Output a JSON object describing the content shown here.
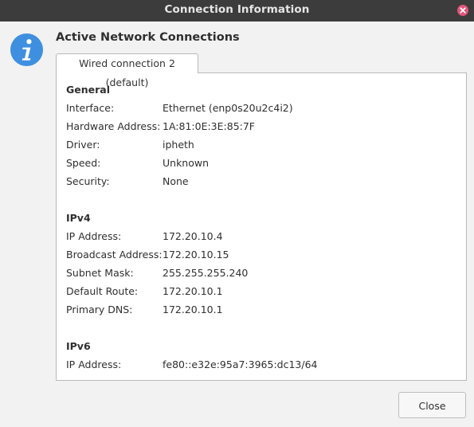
{
  "window": {
    "title": "Connection Information"
  },
  "icons": {
    "info": "info-icon",
    "close": "close-icon"
  },
  "heading": "Active Network Connections",
  "tab": {
    "label": "Wired connection 2 (default)"
  },
  "sections": {
    "general": {
      "title": "General",
      "rows": [
        {
          "label": "Interface:",
          "value": "Ethernet (enp0s20u2c4i2)"
        },
        {
          "label": "Hardware Address:",
          "value": "1A:81:0E:3E:85:7F"
        },
        {
          "label": "Driver:",
          "value": "ipheth"
        },
        {
          "label": "Speed:",
          "value": "Unknown"
        },
        {
          "label": "Security:",
          "value": "None"
        }
      ]
    },
    "ipv4": {
      "title": "IPv4",
      "rows": [
        {
          "label": "IP Address:",
          "value": "172.20.10.4"
        },
        {
          "label": "Broadcast Address:",
          "value": "172.20.10.15"
        },
        {
          "label": "Subnet Mask:",
          "value": "255.255.255.240"
        },
        {
          "label": "Default Route:",
          "value": "172.20.10.1"
        },
        {
          "label": "Primary DNS:",
          "value": "172.20.10.1"
        }
      ]
    },
    "ipv6": {
      "title": "IPv6",
      "rows": [
        {
          "label": "IP Address:",
          "value": "fe80::e32e:95a7:3965:dc13/64"
        }
      ]
    }
  },
  "buttons": {
    "close_label": "Close"
  },
  "colors": {
    "titlebar": "#3c3c3c",
    "close_x": "#e2547a",
    "info_blue": "#3f8fe0"
  }
}
